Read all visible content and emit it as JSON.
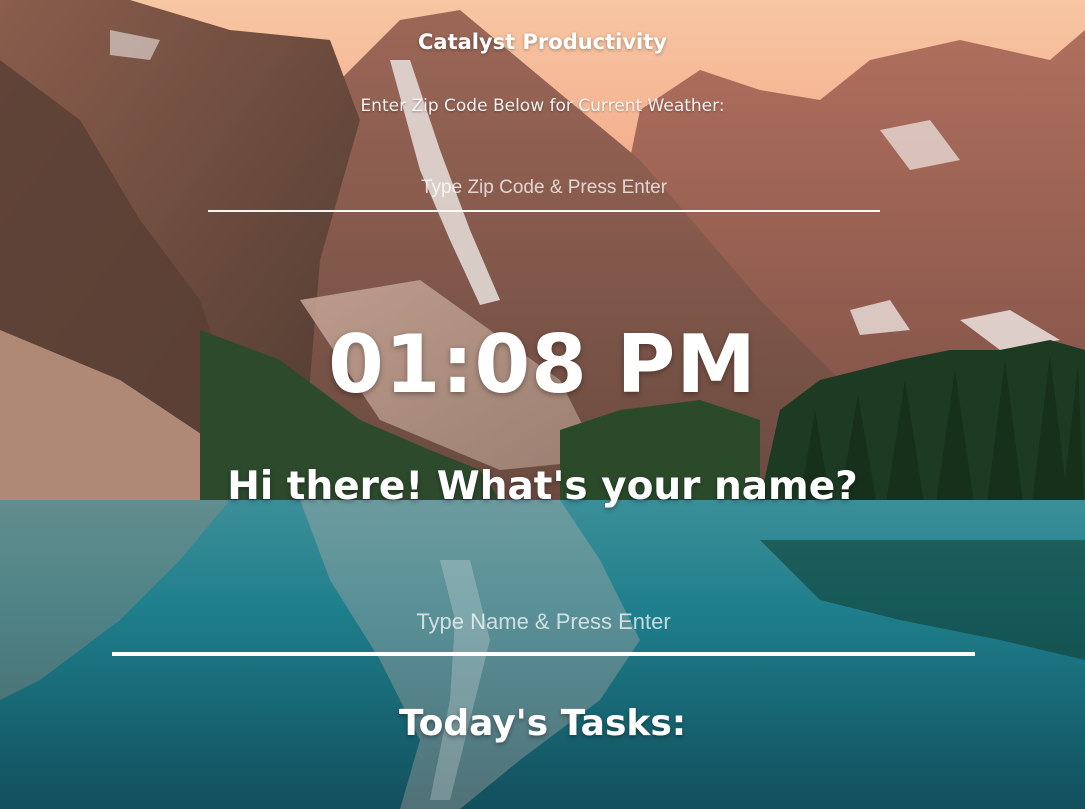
{
  "header": {
    "app_title": "Catalyst Productivity"
  },
  "weather": {
    "prompt": "Enter Zip Code Below for Current Weather:",
    "zip_placeholder": "Type Zip Code & Press Enter",
    "zip_value": ""
  },
  "clock": {
    "time": "01:08 PM"
  },
  "greeting": {
    "text": "Hi there! What's your name?",
    "name_placeholder": "Type Name & Press Enter",
    "name_value": ""
  },
  "tasks": {
    "heading": "Today's Tasks:"
  },
  "background": {
    "description_icon": "mountain-lake-background",
    "colors": {
      "sky_top": "#f6b58a",
      "sky_mid": "#f19a78",
      "mountain": "#8e5a4a",
      "mountain_shadow": "#5b3a33",
      "forest": "#1f3b25",
      "lake": "#1f7f8c",
      "lake_deep": "#135866"
    }
  }
}
